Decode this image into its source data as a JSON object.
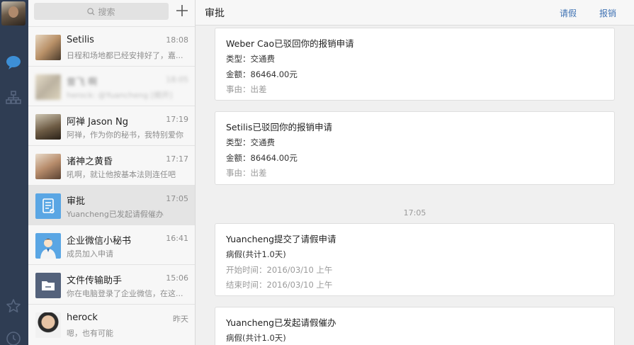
{
  "search": {
    "placeholder": "搜索"
  },
  "conversations": [
    {
      "name": "Setilis",
      "time": "18:08",
      "preview": "日程和场地都已经安排好了，嘉..."
    },
    {
      "name": "曾飞 啊",
      "time": "18:05",
      "preview": "herock: @Yuancheng [频开]"
    },
    {
      "name": "阿禅 Jason Ng",
      "time": "17:19",
      "preview": "阿禅，作为你的秘书，我特别爱你"
    },
    {
      "name": "诸神之黄昏",
      "time": "17:17",
      "preview": "吼啊，就让他按基本法则连任吧"
    },
    {
      "name": "审批",
      "time": "17:05",
      "preview": "Yuancheng已发起请假催办"
    },
    {
      "name": "企业微信小秘书",
      "time": "16:41",
      "preview": "成员加入申请"
    },
    {
      "name": "文件传输助手",
      "time": "15:06",
      "preview": "你在电脑登录了企业微信，在这..."
    },
    {
      "name": "herock",
      "time": "昨天",
      "preview": "嗯，也有可能"
    }
  ],
  "header": {
    "title": "审批",
    "action_leave": "请假",
    "action_expense": "报销"
  },
  "messages": [
    {
      "title": "Weber Cao已驳回你的报销申请",
      "lines": [
        "类型：交通费",
        "金额：86464.00元",
        "事由：出差"
      ]
    },
    {
      "title": "Setilis已驳回你的报销申请",
      "lines": [
        "类型：交通费",
        "金额：86464.00元",
        "事由：出差"
      ]
    },
    {
      "title": "Yuancheng提交了请假申请",
      "lines": [
        "病假(共计1.0天)",
        "开始时间：2016/03/10 上午",
        "结束时间：2016/03/10 上午"
      ]
    },
    {
      "title": "Yuancheng已发起请假催办",
      "lines": [
        "病假(共计1.0天)"
      ]
    }
  ],
  "timestamp": "17:05",
  "colors": {
    "rail": "#2f3d53",
    "accent": "#3f72b3",
    "rail_icon_active": "#3d8fd6"
  }
}
